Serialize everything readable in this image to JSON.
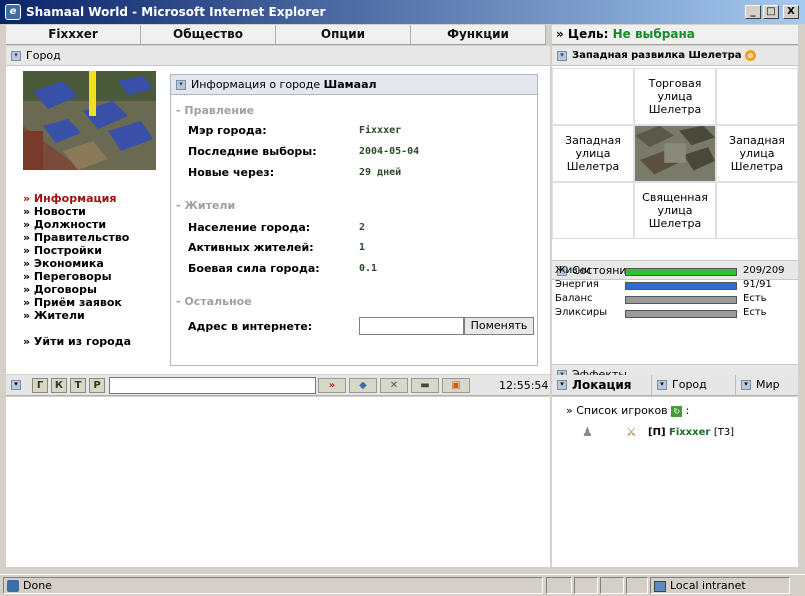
{
  "window": {
    "title": "Shamaal World - Microsoft Internet Explorer",
    "min": "_",
    "max": "□",
    "close": "X"
  },
  "menu": [
    "Fixxxer",
    "Общество",
    "Опции",
    "Функции"
  ],
  "goal": {
    "label": "» Цель:",
    "value": "Не выбрана"
  },
  "left": {
    "section_title": "Город",
    "nav": [
      {
        "label": "» Информация",
        "active": true
      },
      {
        "label": "» Новости"
      },
      {
        "label": "» Должности"
      },
      {
        "label": "» Правительство"
      },
      {
        "label": "» Постройки"
      },
      {
        "label": "» Экономика"
      },
      {
        "label": "» Переговоры"
      },
      {
        "label": "» Договоры"
      },
      {
        "label": "» Приём заявок"
      },
      {
        "label": "» Жители"
      }
    ],
    "exit": "» Уйти из города"
  },
  "info": {
    "title_prefix": "Информация о городе ",
    "title_city": "Шамаал",
    "sec_gov": "- Правление",
    "mayor_label": "Мэр города:",
    "mayor_value": "Fixxxer",
    "elections_label": "Последние выборы:",
    "elections_value": "2004-05-04",
    "next_label": "Новые через:",
    "next_value": "29 дней",
    "sec_people": "- Жители",
    "population_label": "Население города:",
    "population_value": "2",
    "active_label": "Активных жителей:",
    "active_value": "1",
    "power_label": "Боевая сила города:",
    "power_value": "0.1",
    "sec_other": "- Остальное",
    "url_label": "Адрес в интернете:",
    "url_value": "",
    "change_button": "Поменять"
  },
  "map": {
    "title": "Западная развилка Шелетра",
    "north": "Торговая улица Шелетра",
    "west": "Западная улица Шелетра",
    "east": "Западная улица Шелетра",
    "south": "Священная улица Шелетра"
  },
  "status": {
    "title": "Состояние персонажа",
    "rows": [
      {
        "label": "Жизни",
        "value": "209/209",
        "fill": 1.0,
        "color": "#2ec02e"
      },
      {
        "label": "Энергия",
        "value": "91/91",
        "fill": 1.0,
        "color": "#2a6ed8"
      },
      {
        "label": "Баланс",
        "value": "Есть",
        "fill": 1.0,
        "color": "#9a9a9a"
      },
      {
        "label": "Эликсиры",
        "value": "Есть",
        "fill": 1.0,
        "color": "#9a9a9a"
      }
    ]
  },
  "effects": {
    "title": "Эффекты"
  },
  "chat": {
    "buttons": [
      "Г",
      "К",
      "Т",
      "Р"
    ],
    "send": "»",
    "time": "12:55:54"
  },
  "location": {
    "tabs": [
      "Локация",
      "Город",
      "Мир"
    ],
    "players_title": "» Список игроков",
    "players_suffix": ":",
    "player": {
      "clan": "[П]",
      "name": "Fixxxer",
      "level": "[Т3]"
    }
  },
  "statusbar": {
    "done": "Done",
    "zone": "Local intranet"
  }
}
